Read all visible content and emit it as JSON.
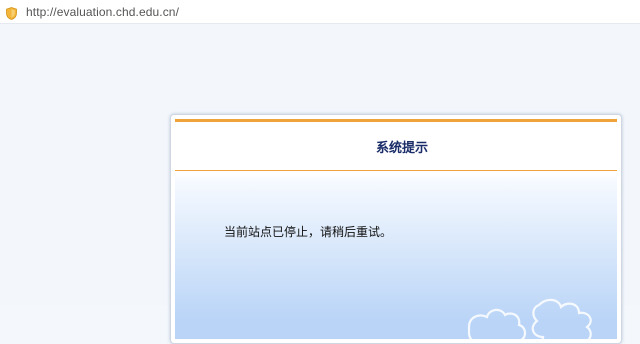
{
  "browser": {
    "url": "http://evaluation.chd.edu.cn/",
    "security_icon": "shield-icon"
  },
  "dialog": {
    "title": "系统提示",
    "message": "当前站点已停止，请稍后重试。",
    "decoration_icon": "puzzle-pieces-icon"
  },
  "colors": {
    "accent": "#f1a33b",
    "title_text": "#1a2d68",
    "gradient_bottom": "#b9d4f7"
  }
}
